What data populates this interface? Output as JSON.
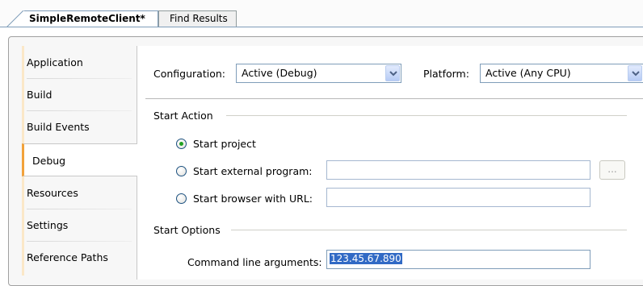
{
  "tabs": {
    "active": "SimpleRemoteClient*",
    "inactive": "Find Results"
  },
  "nav": {
    "items": [
      {
        "label": "Application"
      },
      {
        "label": "Build"
      },
      {
        "label": "Build Events"
      },
      {
        "label": "Debug"
      },
      {
        "label": "Resources"
      },
      {
        "label": "Settings"
      },
      {
        "label": "Reference Paths"
      }
    ],
    "selected": "Debug"
  },
  "config": {
    "configuration_label": "Configuration:",
    "configuration_value": "Active (Debug)",
    "platform_label": "Platform:",
    "platform_value": "Active (Any CPU)"
  },
  "start_action": {
    "title": "Start Action",
    "start_project": "Start project",
    "start_external": "Start external program:",
    "start_browser": "Start browser with URL:",
    "browse_label": "...",
    "selected_option": "Start project"
  },
  "start_options": {
    "title": "Start Options",
    "cmd_args_label": "Command line arguments:",
    "cmd_args_value": "123.45.67.890"
  },
  "colors": {
    "selection_accent": "#f2a23a",
    "radio_dot": "#21a121",
    "text_selection": "#316ac5"
  }
}
